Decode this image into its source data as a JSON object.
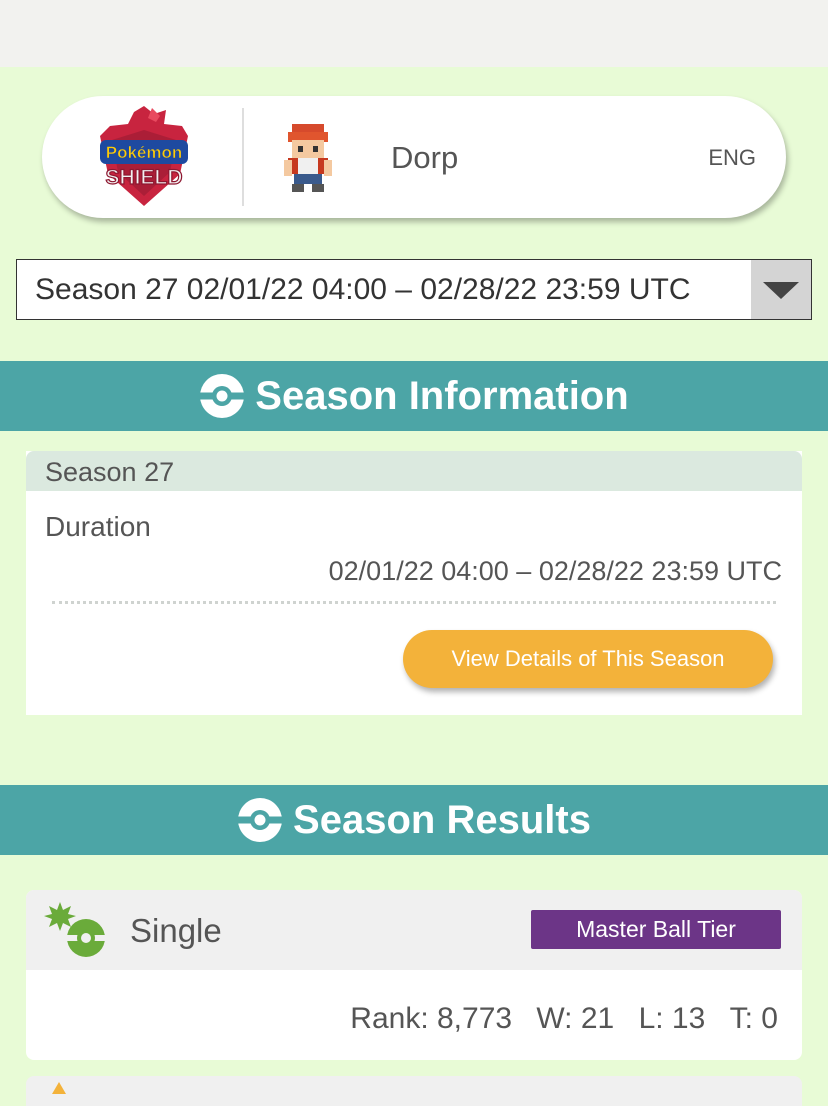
{
  "profile": {
    "game_logo": {
      "top": "Pokémon",
      "bottom": "SHIELD"
    },
    "trainer_name": "Dorp",
    "language": "ENG"
  },
  "season_select": {
    "selected": "Season 27 02/01/22 04:00 – 02/28/22 23:59 UTC"
  },
  "season_information": {
    "title": "Season Information",
    "season_label": "Season 27",
    "duration_label": "Duration",
    "duration_value": "02/01/22 04:00 – 02/28/22 23:59 UTC",
    "view_details_button": "View Details of This Season"
  },
  "season_results": {
    "title": "Season Results",
    "results": [
      {
        "battle_type": "Single",
        "tier": "Master Ball Tier",
        "rank": "Rank: 8,773",
        "wins": "W: 21",
        "losses": "L: 13",
        "ties": "T: 0"
      }
    ]
  },
  "colors": {
    "page_background": "#e8fbd6",
    "section_header": "#4ca5a6",
    "view_button": "#f3b23a",
    "tier_badge": "#6c3587",
    "battle_icon": "#6aab3a"
  },
  "icons": {
    "section": "poke-ball-icon",
    "battle_single": "single-battle-icon",
    "avatar": "trainer-sprite",
    "select": "dropdown-arrow-icon"
  }
}
